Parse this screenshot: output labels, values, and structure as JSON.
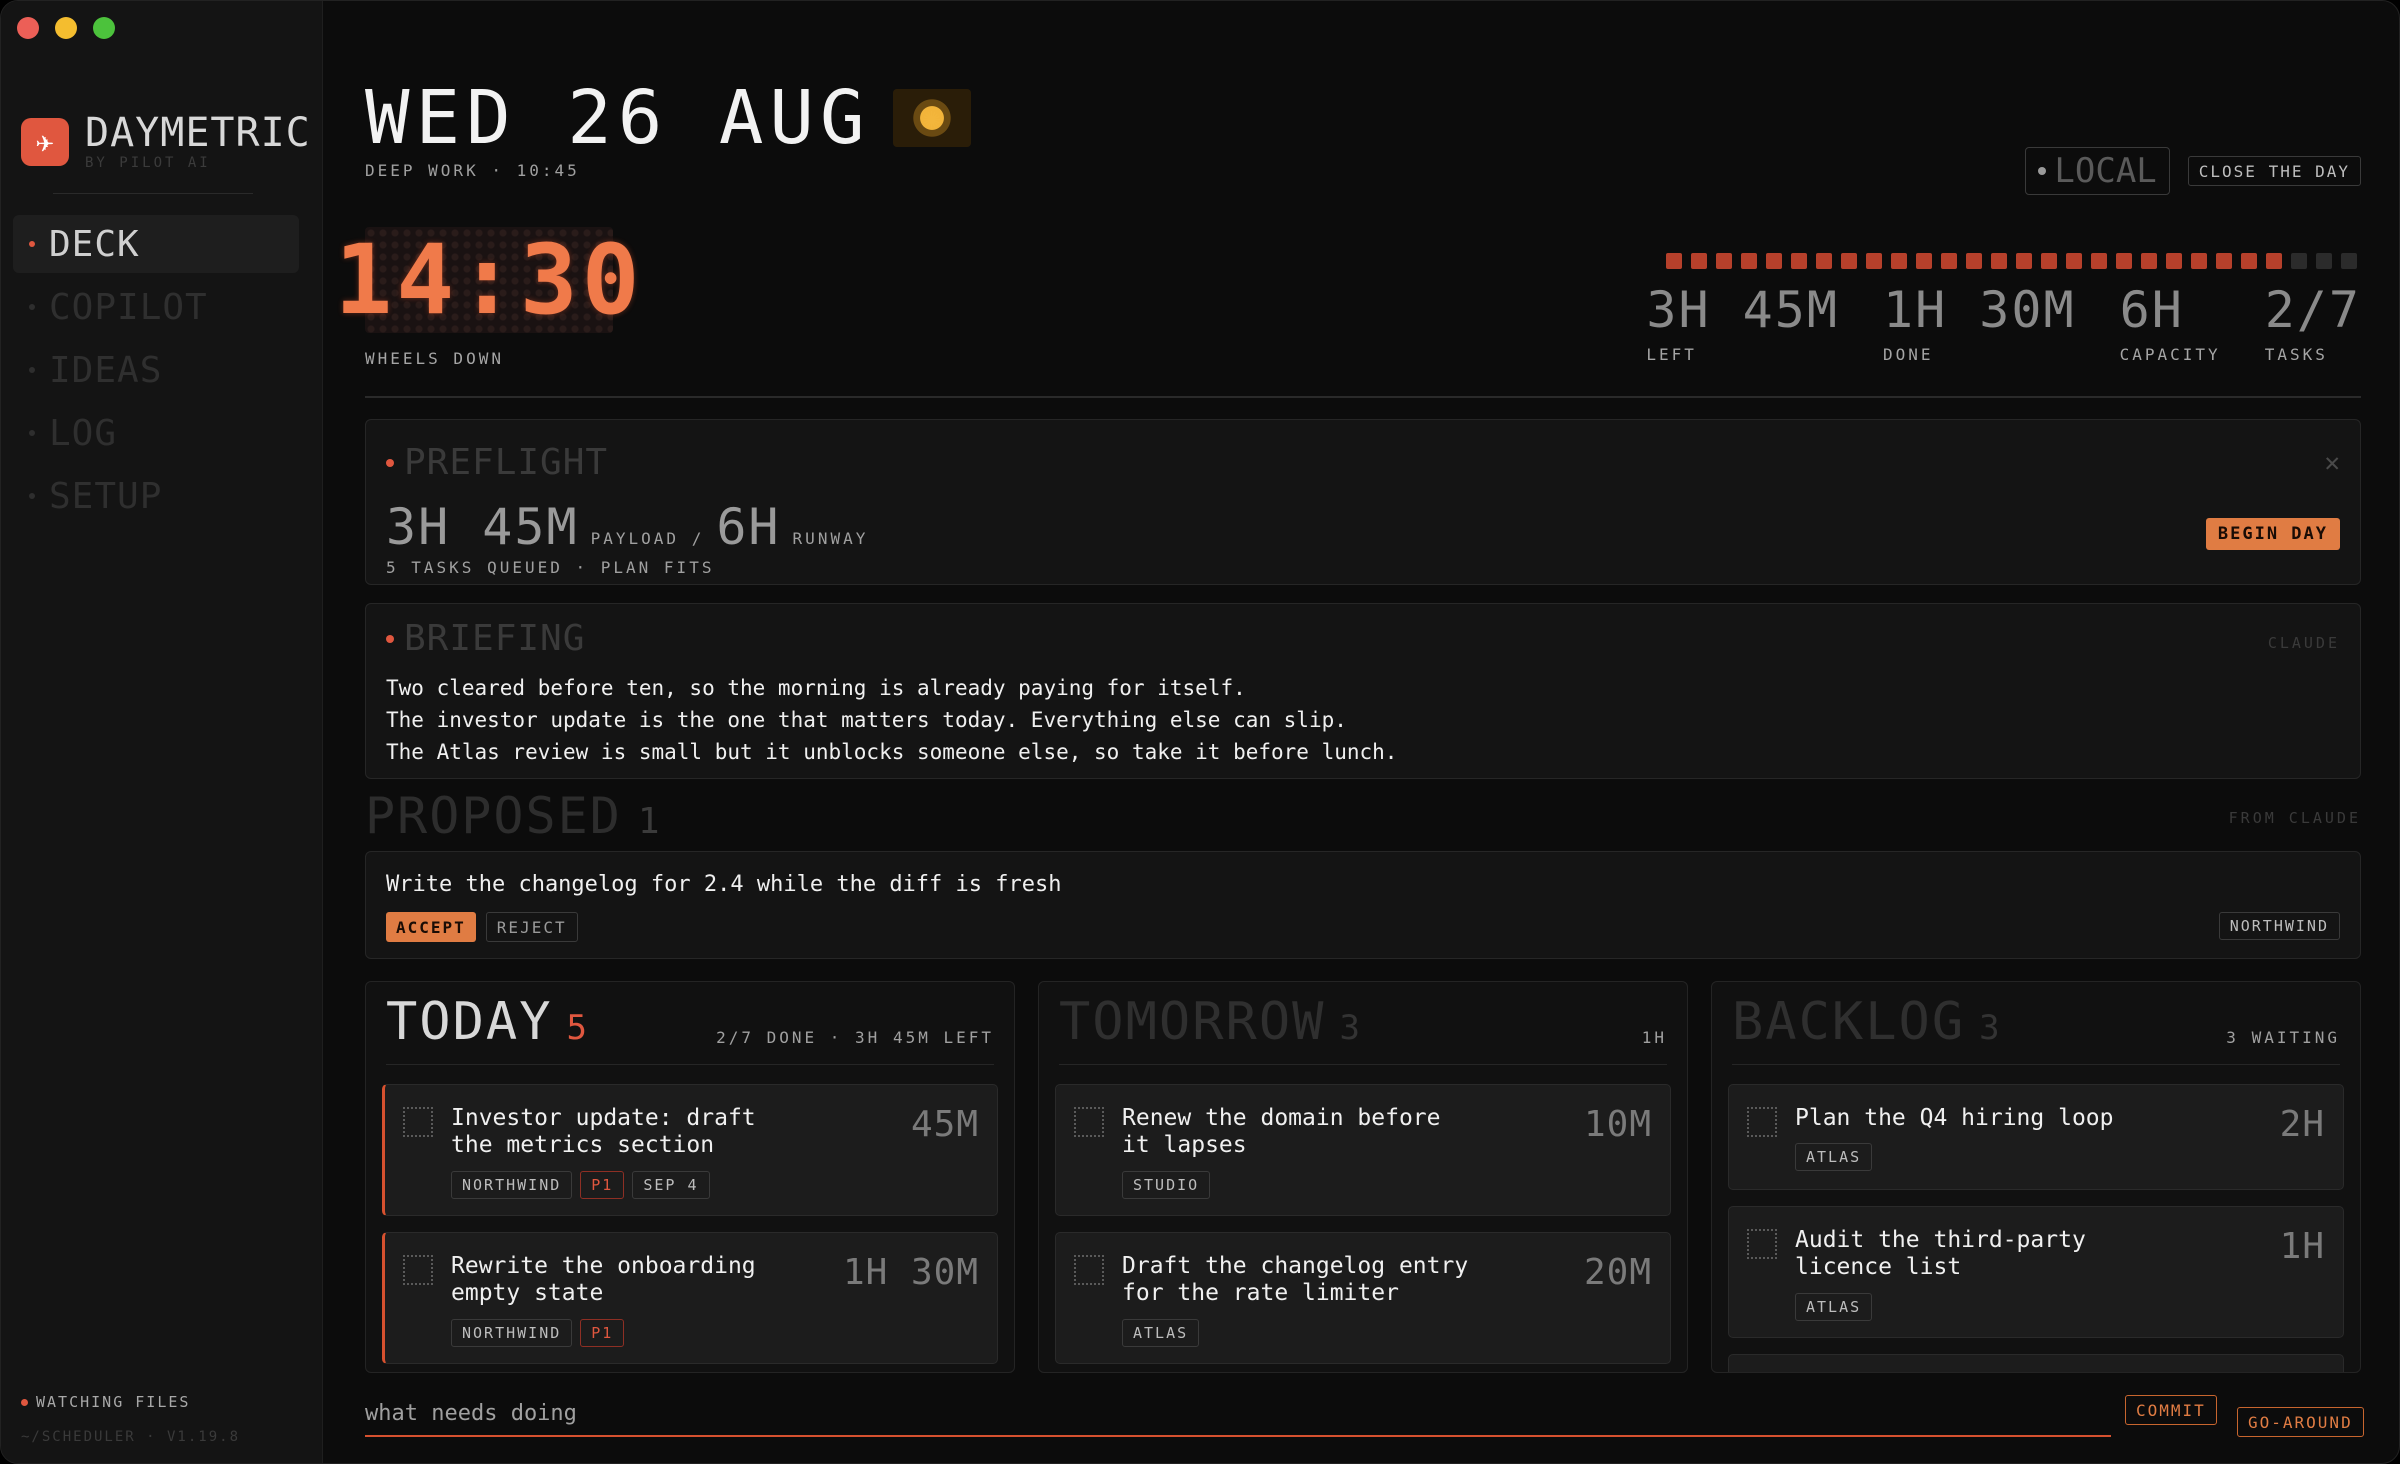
{
  "brand": {
    "name": "DAYMETRIC",
    "sub": "BY PILOT AI",
    "logo_icon": "airplane-icon",
    "accent": "#e0573f"
  },
  "nav": {
    "items": [
      {
        "label": "DECK",
        "active": true
      },
      {
        "label": "COPILOT",
        "active": false
      },
      {
        "label": "IDEAS",
        "active": false
      },
      {
        "label": "LOG",
        "active": false
      },
      {
        "label": "SETUP",
        "active": false
      }
    ]
  },
  "footer": {
    "watching": "WATCHING FILES",
    "version": "~/SCHEDULER · V1.19.8"
  },
  "header": {
    "date": "WED 26 AUG",
    "weather_icon": "sun-icon",
    "mode": "DEEP WORK · 10:45",
    "local_label": "LOCAL",
    "close_day": "CLOSE THE DAY"
  },
  "clock": {
    "time": "14:30",
    "label": "WHEELS DOWN"
  },
  "progress": {
    "total": 28,
    "filled": 25
  },
  "stats": [
    {
      "value": "3H 45M",
      "label": "LEFT"
    },
    {
      "value": "1H 30M",
      "label": "DONE"
    },
    {
      "value": "6H",
      "label": "CAPACITY"
    },
    {
      "value": "2/7",
      "label": "TASKS"
    }
  ],
  "preflight": {
    "title": "PREFLIGHT",
    "payload": "3H 45M",
    "payload_label": "PAYLOAD /",
    "runway": "6H",
    "runway_label": "RUNWAY",
    "note": "5 TASKS QUEUED · PLAN FITS",
    "begin": "BEGIN DAY"
  },
  "briefing": {
    "title": "BRIEFING",
    "source": "CLAUDE",
    "lines": [
      "Two cleared before ten, so the morning is already paying for itself.",
      "The investor update is the one that matters today. Everything else can slip.",
      "The Atlas review is small but it unblocks someone else, so take it before lunch."
    ]
  },
  "proposed": {
    "title": "PROPOSED",
    "count": "1",
    "source": "FROM CLAUDE",
    "item": "Write the changelog for 2.4 while the diff is fresh",
    "accept": "ACCEPT",
    "reject": "REJECT",
    "tag": "NORTHWIND"
  },
  "columns": {
    "today": {
      "title": "TODAY",
      "count": "5",
      "meta": "2/7 DONE · 3H 45M LEFT",
      "tasks": [
        {
          "title": "Investor update: draft the metrics section",
          "duration": "45M",
          "tags": [
            "NORTHWIND",
            "P1",
            "SEP 4"
          ]
        },
        {
          "title": "Rewrite the onboarding empty state",
          "duration": "1H 30M",
          "tags": [
            "NORTHWIND",
            "P1"
          ]
        }
      ]
    },
    "tomorrow": {
      "title": "TOMORROW",
      "count": "3",
      "meta": "1H",
      "tasks": [
        {
          "title": "Renew the domain before it lapses",
          "duration": "10M",
          "tags": [
            "STUDIO"
          ]
        },
        {
          "title": "Draft the changelog entry for the rate limiter",
          "duration": "20M",
          "tags": [
            "ATLAS"
          ]
        }
      ]
    },
    "backlog": {
      "title": "BACKLOG",
      "count": "3",
      "meta": "3 WAITING",
      "tasks": [
        {
          "title": "Plan the Q4 hiring loop",
          "duration": "2H",
          "tags": [
            "ATLAS"
          ]
        },
        {
          "title": "Audit the third-party licence list",
          "duration": "1H",
          "tags": [
            "ATLAS"
          ]
        }
      ]
    }
  },
  "composer": {
    "placeholder": "what needs doing",
    "commit": "COMMIT",
    "goaround": "GO-AROUND"
  }
}
